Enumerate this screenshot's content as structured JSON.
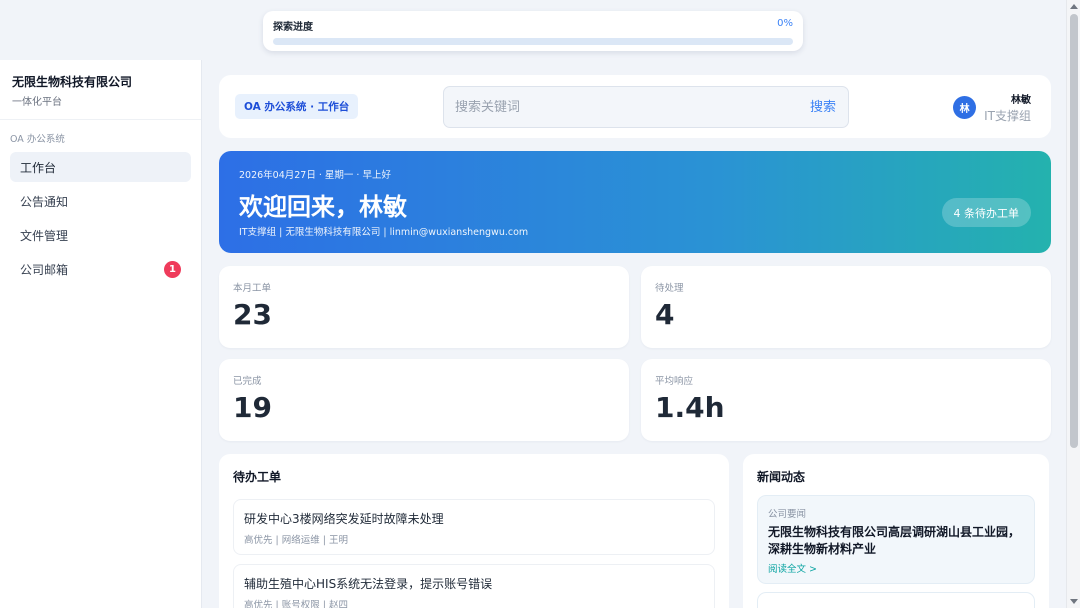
{
  "progress": {
    "label": "探索进度",
    "percent_text": "0%",
    "fraction": 0
  },
  "sidebar": {
    "brand_name": "无限生物科技有限公司",
    "brand_sub": "一体化平台",
    "section": "OA 办公系统",
    "items": [
      {
        "label": "工作台",
        "active": true
      },
      {
        "label": "公告通知"
      },
      {
        "label": "文件管理"
      },
      {
        "label": "公司邮箱",
        "badge": "1"
      }
    ]
  },
  "header": {
    "chip": "OA 办公系统 · 工作台",
    "search_placeholder": "搜索关键词",
    "search_button": "搜索",
    "user_avatar": "林",
    "user_name": "林敏",
    "user_group": "IT支撑组"
  },
  "hero": {
    "date_line": "2026年04月27日 · 星期一 · 早上好",
    "greeting": "欢迎回来，林敏",
    "info": "IT支撑组 | 无限生物科技有限公司 | linmin@wuxianshengwu.com",
    "pending": "4 条待办工单"
  },
  "stats": [
    {
      "label": "本月工单",
      "value": "23"
    },
    {
      "label": "待处理",
      "value": "4"
    },
    {
      "label": "已完成",
      "value": "19"
    },
    {
      "label": "平均响应",
      "value": "1.4h"
    }
  ],
  "todo": {
    "title": "待办工单",
    "items": [
      {
        "title": "研发中心3楼网络突发延时故障未处理",
        "meta": "高优先 | 网络运维 | 王明"
      },
      {
        "title": "辅助生殖中心HIS系统无法登录，提示账号错误",
        "meta": "高优先 | 账号权限 | 赵四"
      }
    ]
  },
  "news": {
    "title": "新闻动态",
    "items": [
      {
        "tag": "公司要闻",
        "title": "无限生物科技有限公司高层调研湖山县工业园，深耕生物新材料产业",
        "link": "阅读全文 >"
      }
    ]
  },
  "colors": {
    "accent": "#3b82f6",
    "badge": "#ef3b5b",
    "hero_start": "#2d6fe6",
    "hero_end": "#24b2ae"
  }
}
